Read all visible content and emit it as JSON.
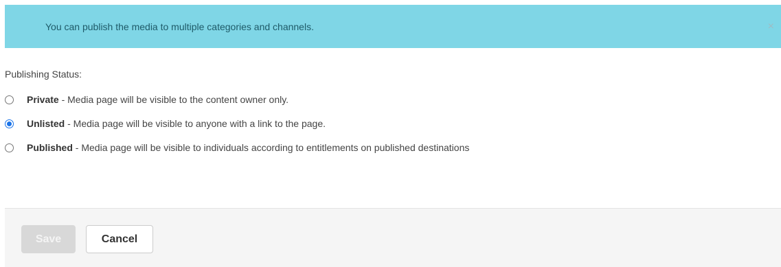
{
  "alert": {
    "message": "You can publish the media to multiple categories and channels.",
    "close_glyph": "×"
  },
  "publishing": {
    "label": "Publishing Status:",
    "options": [
      {
        "name": "Private",
        "description": " - Media page will be visible to the content owner only.",
        "checked": false
      },
      {
        "name": "Unlisted",
        "description": " - Media page will be visible to anyone with a link to the page.",
        "checked": true
      },
      {
        "name": "Published",
        "description": " - Media page will be visible to individuals according to entitlements on published destinations",
        "checked": false
      }
    ]
  },
  "footer": {
    "save_label": "Save",
    "cancel_label": "Cancel"
  },
  "colors": {
    "alert_bg": "#7fd6e6",
    "radio_accent": "#1a73e8",
    "footer_bg": "#f5f5f5",
    "save_disabled_bg": "#d8d8d8"
  },
  "icons": {
    "close": "close-icon"
  }
}
